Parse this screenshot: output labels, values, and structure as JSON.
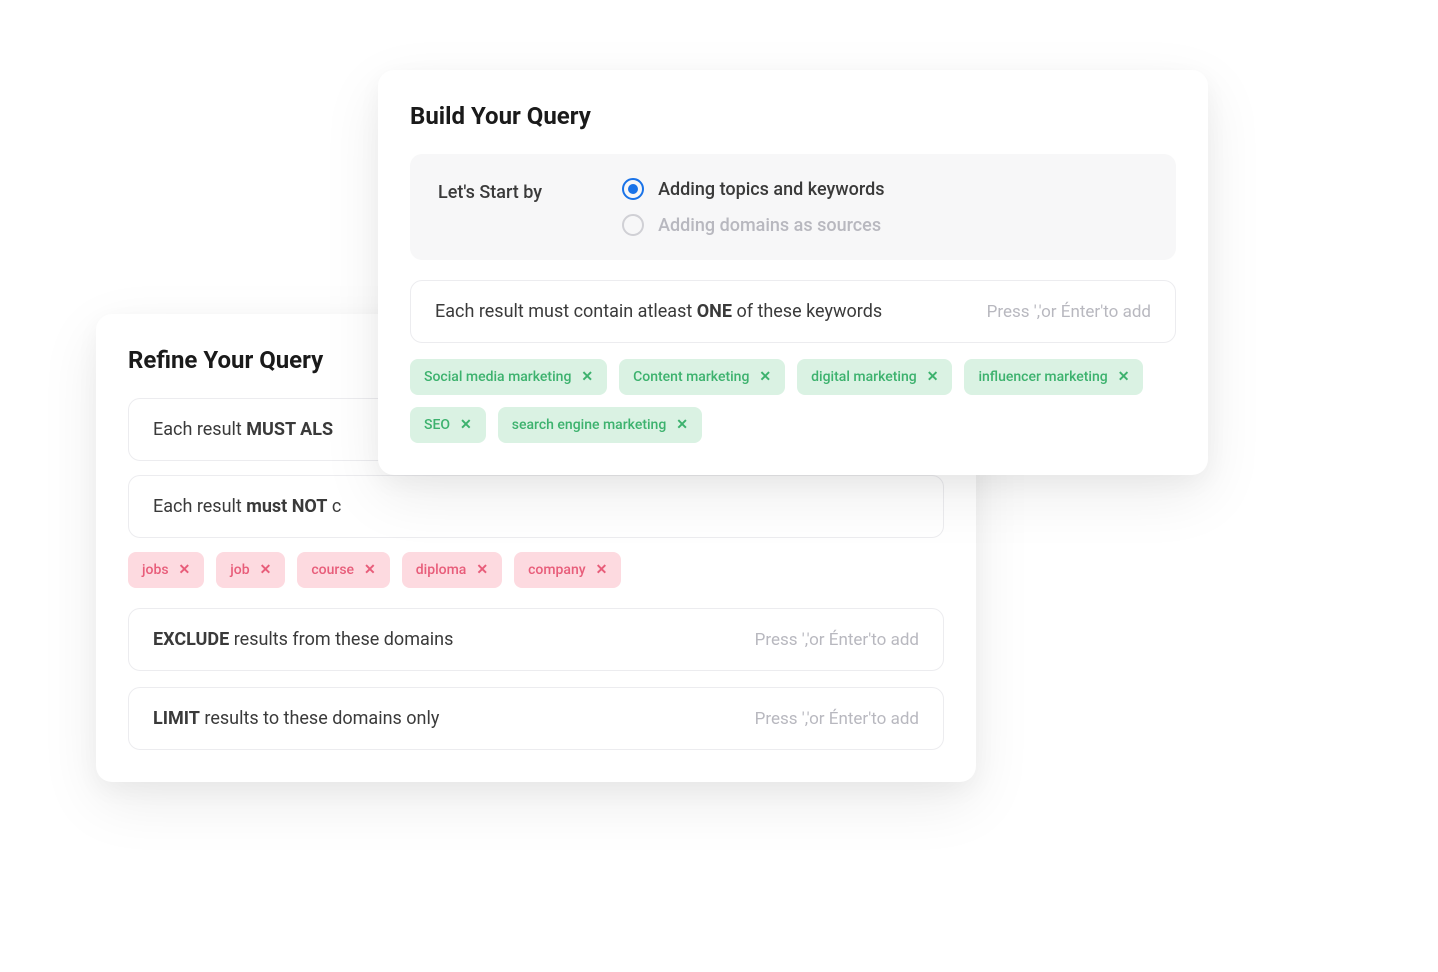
{
  "refine": {
    "title": "Refine Your Query",
    "mustAlso": {
      "prefix": "Each result ",
      "bold": "MUST ALS"
    },
    "mustNot": {
      "prefix": "Each result ",
      "bold": "must NOT",
      "suffix": " c"
    },
    "notTags": [
      "jobs",
      "job",
      "course",
      "diploma",
      "company"
    ],
    "exclude": {
      "bold": "EXCLUDE",
      "suffix": " results from these domains",
      "placeholder": "Press ','or Énter'to add"
    },
    "limit": {
      "bold": "LIMIT",
      "suffix": " results to these domains only",
      "placeholder": "Press ','or Énter'to add"
    }
  },
  "build": {
    "title": "Build Your Query",
    "startLabel": "Let's Start by",
    "radio1": "Adding topics and keywords",
    "radio2": "Adding domains as sources",
    "keywords": {
      "prefix": "Each result must contain atleast ",
      "bold": "ONE",
      "suffix": " of these keywords",
      "placeholder": "Press ','or Énter'to add"
    },
    "tags": [
      "Social media marketing",
      "Content marketing",
      "digital marketing",
      "influencer marketing",
      "SEO",
      "search engine marketing"
    ]
  }
}
